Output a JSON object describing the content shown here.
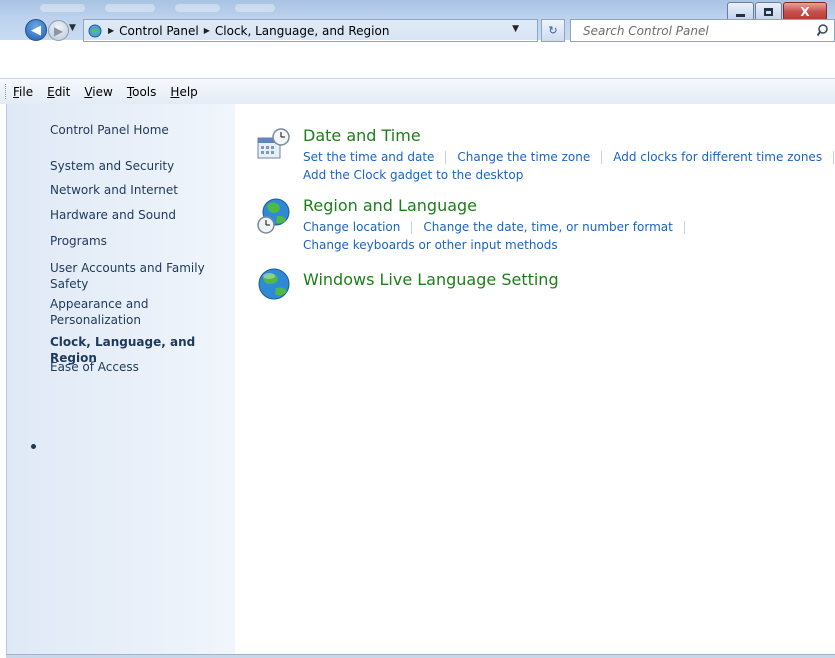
{
  "window": {
    "caption_buttons": {
      "close_glyph": "X"
    }
  },
  "nav": {
    "breadcrumb": [
      "Control Panel",
      "Clock, Language, and Region"
    ],
    "search_placeholder": "Search Control Panel"
  },
  "menu": [
    {
      "label": "File",
      "key": "F",
      "rest": "ile"
    },
    {
      "label": "Edit",
      "key": "E",
      "rest": "dit"
    },
    {
      "label": "View",
      "key": "V",
      "rest": "iew"
    },
    {
      "label": "Tools",
      "key": "T",
      "rest": "ools"
    },
    {
      "label": "Help",
      "key": "H",
      "rest": "elp"
    }
  ],
  "sidebar": {
    "items": [
      "Control Panel Home",
      "System and Security",
      "Network and Internet",
      "Hardware and Sound",
      "Programs",
      "User Accounts and Family Safety",
      "Appearance and Personalization",
      "Clock, Language, and Region",
      "Ease of Access"
    ],
    "current": "Clock, Language, and Region"
  },
  "categories": [
    {
      "title": "Date and Time",
      "icon": "calendar-clock-icon",
      "tasks_row1": [
        "Set the time and date",
        "Change the time zone",
        "Add clocks for different time zones"
      ],
      "tasks_row2": [
        "Add the Clock gadget to the desktop"
      ]
    },
    {
      "title": "Region and Language",
      "icon": "globe-clock-icon",
      "tasks_row1": [
        "Change location",
        "Change the date, time, or number format"
      ],
      "tasks_row2": [
        "Change keyboards or other input methods"
      ]
    },
    {
      "title": "Windows Live Language Setting",
      "icon": "globe-icon",
      "tasks_row1": [],
      "tasks_row2": []
    }
  ],
  "colors": {
    "category_title": "#1d7f1a",
    "task_link": "#1a64c4",
    "sidebar_text": "#1e395b"
  }
}
